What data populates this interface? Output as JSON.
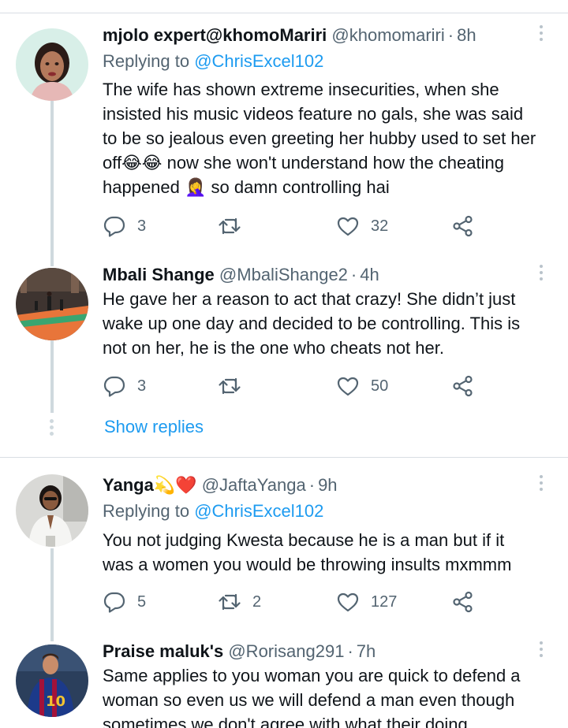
{
  "tweets": [
    {
      "display_name": "mjolo expert@khomoMariri",
      "handle": "@khomomariri",
      "time": "8h",
      "replying_prefix": "Replying to",
      "replying_to": "@ChrisExcel102",
      "lines": [
        "The wife has shown extreme insecurities, when she",
        "insisted his music videos feature no gals, she was said",
        "to be so jealous even greeting her hubby used to set her",
        "off😂😂 now she won't understand how the cheating",
        "happened 🤦‍♀️ so damn controlling hai"
      ],
      "replies": "3",
      "retweets": "",
      "likes": "32"
    },
    {
      "display_name": "Mbali Shange",
      "handle": "@MbaliShange2",
      "time": "4h",
      "lines": [
        "He gave her a reason to act that crazy! She didn’t just",
        "wake up one day and decided to be controlling. This is",
        "not on her, he is the one who cheats not her."
      ],
      "replies": "3",
      "retweets": "",
      "likes": "50"
    },
    {
      "display_name": "Yanga💫❤️",
      "handle": "@JaftaYanga",
      "time": "9h",
      "replying_prefix": "Replying to",
      "replying_to": "@ChrisExcel102",
      "lines": [
        "You not judging Kwesta because he is a man but if it",
        "was a women you would be throwing insults mxmmm"
      ],
      "replies": "5",
      "retweets": "2",
      "likes": "127"
    },
    {
      "display_name": "Praise maluk's",
      "handle": "@Rorisang291",
      "time": "7h",
      "lines": [
        "Same applies to you woman you are quick to defend a",
        "woman so even us we will defend a man even though",
        "sometimes we don't agree with what their doing"
      ]
    }
  ],
  "show_replies_label": "Show replies",
  "separator": "·",
  "colors": {
    "link": "#1d9bf0",
    "secondary_text": "#536471",
    "primary_text": "#0f1419",
    "thread_line": "#cfd9de"
  },
  "icons": [
    "reply-icon",
    "retweet-icon",
    "like-icon",
    "share-icon",
    "more-icon"
  ]
}
